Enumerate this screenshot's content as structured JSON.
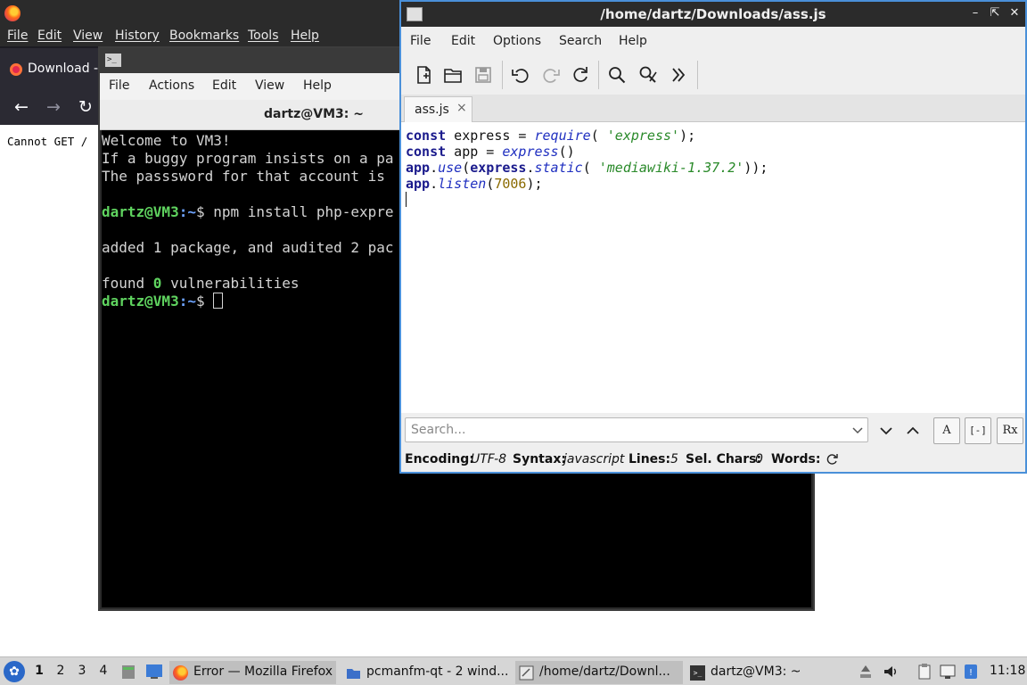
{
  "firefox": {
    "menu": [
      "File",
      "Edit",
      "View",
      "History",
      "Bookmarks",
      "Tools",
      "Help"
    ],
    "tab_label": "Download -",
    "page_text": "Cannot GET /"
  },
  "terminal": {
    "menu": [
      "File",
      "Actions",
      "Edit",
      "View",
      "Help"
    ],
    "title": "dartz@VM3: ~",
    "lines": {
      "l1": "Welcome to VM3!",
      "l2": "If a buggy program insists on a pa",
      "l3": "The passsword for that account is",
      "cmd_user": "dartz@VM3",
      "cmd_path": ":~",
      "cmd_text": "$ npm install php-expre",
      "added": "added 1 package, and audited 2 pac",
      "found_pre": "found ",
      "found_num": "0",
      "found_post": " vulnerabilities",
      "prompt_user": "dartz@VM3",
      "prompt_path": ":~",
      "prompt_text": "$ "
    }
  },
  "editor": {
    "title": "/home/dartz/Downloads/ass.js",
    "menu": [
      "File",
      "Edit",
      "Options",
      "Search",
      "Help"
    ],
    "tab_label": "ass.js",
    "code": {
      "l1_kw": "const",
      "l1_a": " express = ",
      "l1_fn": "require",
      "l1_b": "( ",
      "l1_str": "'express'",
      "l1_c": ");",
      "l2_kw": "const",
      "l2_a": " app = ",
      "l2_fn": "express",
      "l2_b": "()",
      "l3_obj": "app",
      "l3_dot": ".",
      "l3_fn": "use",
      "l3_a": "(",
      "l3_obj2": "express",
      "l3_dot2": ".",
      "l3_fn2": "static",
      "l3_b": "( ",
      "l3_str": "'mediawiki-1.37.2'",
      "l3_c": "));",
      "l4_obj": "app",
      "l4_dot": ".",
      "l4_fn": "listen",
      "l4_a": "(",
      "l4_num": "7006",
      "l4_b": ");"
    },
    "search_placeholder": "Search...",
    "status": {
      "encoding_label": "Encoding:",
      "encoding_value": "UTF-8",
      "syntax_label": "Syntax:",
      "syntax_value": "javascript",
      "lines_label": "Lines:",
      "lines_value": "5",
      "sel_label": "Sel. Chars:",
      "sel_value": "0",
      "words_label": "Words:"
    },
    "search_buttons": {
      "match_case": "A",
      "whole_word": "[-]",
      "regex": "Rx"
    }
  },
  "taskbar": {
    "workspaces": [
      "1",
      "2",
      "3",
      "4"
    ],
    "apps": [
      {
        "label": "Error — Mozilla Firefox"
      },
      {
        "label": "pcmanfm-qt - 2 wind..."
      },
      {
        "label": "/home/dartz/Downl..."
      },
      {
        "label": "dartz@VM3: ~"
      }
    ],
    "clock": "11:18"
  },
  "colors": {
    "accent": "#4a90d9",
    "term_green": "#5fd35f",
    "term_blue": "#6ea4ff"
  }
}
